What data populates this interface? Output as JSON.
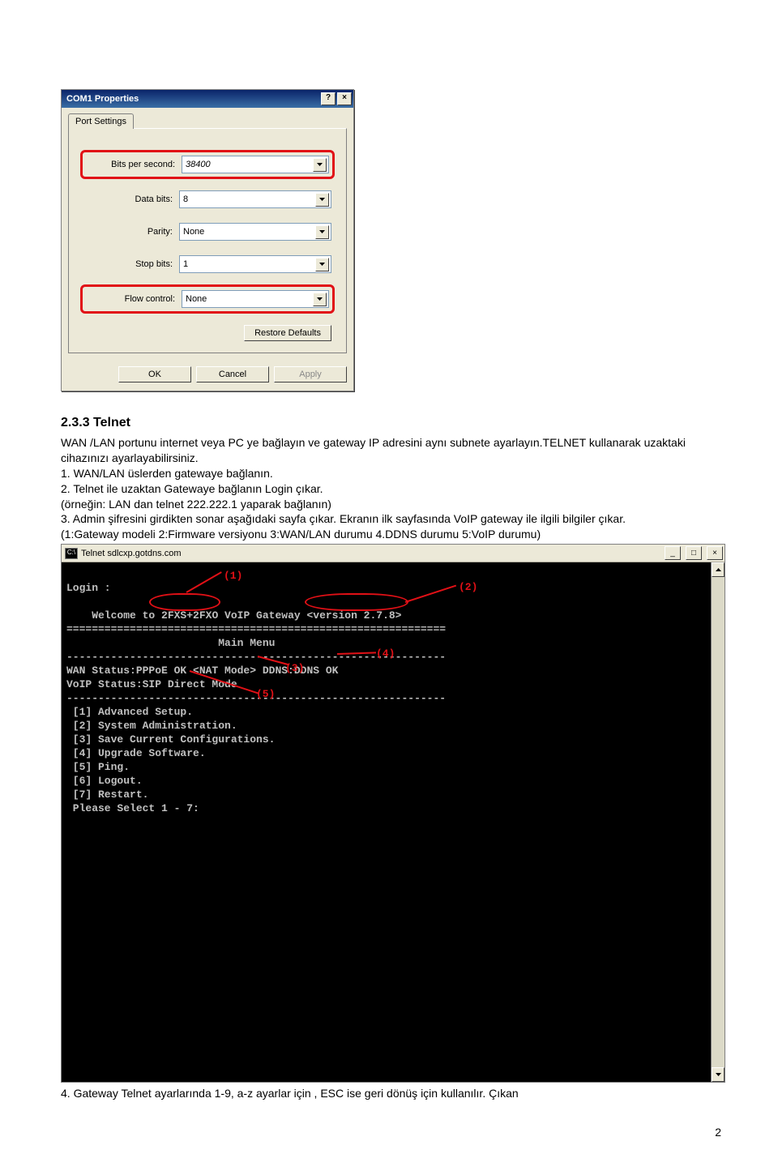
{
  "dialog": {
    "title": "COM1 Properties",
    "help_btn": "?",
    "close_btn": "×",
    "tab_label": "Port Settings",
    "rows": {
      "bits_per_second": {
        "label": "Bits per second:",
        "value": "38400"
      },
      "data_bits": {
        "label": "Data bits:",
        "value": "8"
      },
      "parity": {
        "label": "Parity:",
        "value": "None"
      },
      "stop_bits": {
        "label": "Stop bits:",
        "value": "1"
      },
      "flow_control": {
        "label": "Flow control:",
        "value": "None"
      }
    },
    "restore_btn": "Restore Defaults",
    "ok_btn": "OK",
    "cancel_btn": "Cancel",
    "apply_btn": "Apply"
  },
  "doc": {
    "heading": "2.3.3 Telnet",
    "p1": "WAN /LAN portunu internet veya  PC ye bağlayın ve gateway IP adresini aynı subnete ayarlayın.TELNET kullanarak uzaktaki cihazınızı ayarlayabilirsiniz.",
    "l1": "1. WAN/LAN  üslerden gatewaye bağlanın.",
    "l2": "2. Telnet ile uzaktan Gatewaye bağlanın Login çıkar.",
    "l2b": "(örneğin: LAN dan telnet 222.222.1 yaparak bağlanın)",
    "l3": "3. Admin şifresini girdikten sonar aşağıdaki sayfa  çıkar. Ekranın ilk sayfasında VoIP gateway ile ilgili bilgiler çıkar.",
    "l3b": "(1:Gateway modeli 2:Firmware versiyonu 3:WAN/LAN  durumu  4.DDNS durumu  5:VoIP durumu)",
    "l4": "4. Gateway Telnet ayarlarında 1-9, a-z ayarlar için , ESC ise geri dönüş için kullanılır. Çıkan"
  },
  "telnet": {
    "title": "Telnet sdlcxp.gotdns.com",
    "minimize": "_",
    "maximize": "□",
    "close": "×",
    "login": "Login :",
    "welcome_pre": "    Welcome to ",
    "model": "2FXS+2FXO",
    "welcome_mid": " VoIP Gateway ",
    "version": "<version 2.7.8>",
    "separator": "============================================================",
    "main_menu": "                        Main Menu",
    "separator2": "------------------------------------------------------------",
    "wan_status": "WAN Status:PPPoE OK <NAT Mode> DDNS:DDNS OK",
    "voip_status": "VoIP Status:SIP Direct Mode",
    "separator3": "------------------------------------------------------------",
    "m1": " [1] Advanced Setup.",
    "m2": " [2] System Administration.",
    "m3": " [3] Save Current Configurations.",
    "m4": " [4] Upgrade Software.",
    "m5": " [5] Ping.",
    "m6": " [6] Logout.",
    "m7": " [7] Restart.",
    "prompt": " Please Select 1 - 7:",
    "annots": {
      "a1": "(1)",
      "a2": "(2)",
      "a3": "(3)",
      "a4": "(4)",
      "a5": "(5)"
    }
  },
  "page_number": "2"
}
